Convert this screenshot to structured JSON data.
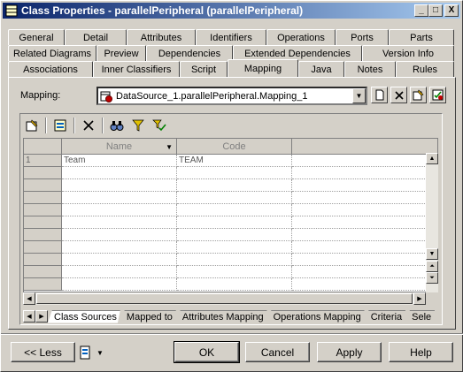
{
  "window": {
    "title": "Class Properties - parallelPeripheral (parallelPeripheral)",
    "minimize_glyph": "_",
    "maximize_glyph": "□",
    "close_glyph": "X"
  },
  "tabs": {
    "row1": [
      "General",
      "Detail",
      "Attributes",
      "Identifiers",
      "Operations",
      "Ports",
      "Parts"
    ],
    "row2": [
      "Related Diagrams",
      "Preview",
      "Dependencies",
      "Extended Dependencies",
      "Version Info"
    ],
    "row3": [
      "Associations",
      "Inner Classifiers",
      "Script",
      "Mapping",
      "Java",
      "Notes",
      "Rules"
    ],
    "active": "Mapping"
  },
  "mapping": {
    "label": "Mapping:",
    "value": "DataSource_1.parallelPeripheral.Mapping_1"
  },
  "grid": {
    "columns": [
      "Name",
      "Code"
    ],
    "rows": [
      {
        "num": "1",
        "name": "Team",
        "code": "TEAM"
      }
    ]
  },
  "subtabs": [
    "Class Sources",
    "Mapped to",
    "Attributes Mapping",
    "Operations Mapping",
    "Criteria",
    "Sele"
  ],
  "buttons": {
    "less": "<< Less",
    "ok": "OK",
    "cancel": "Cancel",
    "apply": "Apply",
    "help": "Help"
  },
  "icons": {
    "toolbar": [
      "properties-icon",
      "add-objects-icon",
      "delete-icon",
      "find-icon",
      "filter-icon",
      "check-filter-icon"
    ],
    "mapping_side": [
      "new-icon",
      "delete-icon",
      "properties-icon",
      "check-icon"
    ]
  }
}
